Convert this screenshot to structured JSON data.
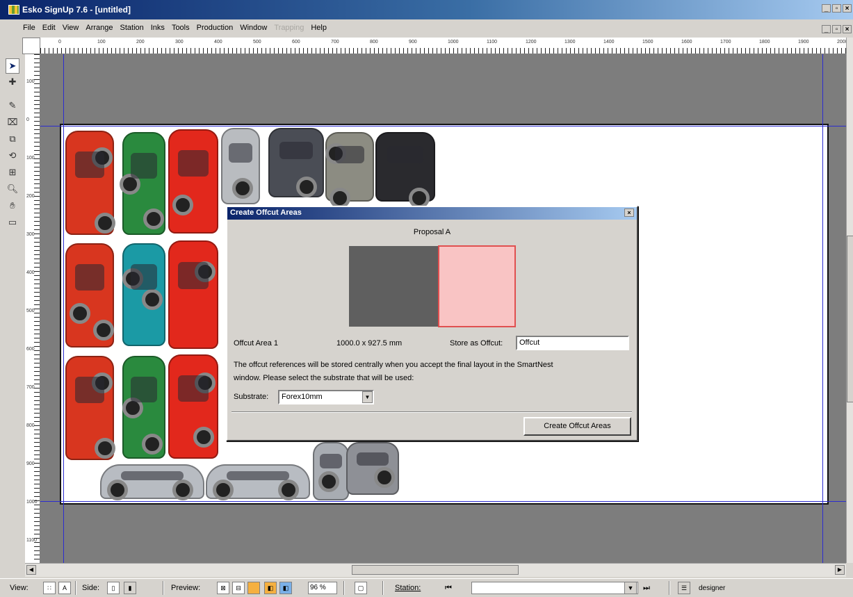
{
  "window": {
    "title": "Esko SignUp 7.6 - [untitled]",
    "controls": [
      "_",
      "̈",
      "x"
    ]
  },
  "menu": {
    "items": [
      "File",
      "Edit",
      "View",
      "Arrange",
      "Station",
      "Inks",
      "Tools",
      "Production",
      "Window",
      "Trapping",
      "Help"
    ],
    "disabled": [
      "Trapping"
    ]
  },
  "ruler": {
    "top_labels": [
      "0",
      "100",
      "200",
      "300",
      "400",
      "500",
      "600",
      "700",
      "800",
      "900",
      "1000",
      "1100",
      "1200",
      "1300",
      "1400",
      "1500",
      "1600",
      "1700",
      "1800",
      "1900",
      "2000"
    ],
    "left_labels": [
      "100",
      "0",
      "100",
      "200",
      "300",
      "400",
      "500",
      "600",
      "700",
      "800",
      "900",
      "1000",
      "1100"
    ]
  },
  "tools": [
    "select-arrow-icon",
    "node-edit-icon",
    "pencil-icon",
    "crop-icon",
    "transform-icon",
    "rotate-icon",
    "distort-icon",
    "zoom-icon",
    "hand-icon",
    "measure-icon"
  ],
  "dialog": {
    "title": "Create Offcut Areas",
    "close": "x",
    "proposal": "Proposal A",
    "area_label": "Offcut Area 1",
    "area_size": "1000.0 x  927.5 mm",
    "store_label": "Store as Offcut:",
    "store_value": "Offcut",
    "info_line1": "The offcut references will be stored centrally when you accept the final layout in the SmartNest",
    "info_line2": "window. Please select the substrate that will be used:",
    "substrate_label": "Substrate:",
    "substrate_value": "Forex10mm",
    "create_button": "Create Offcut Areas"
  },
  "status": {
    "view_label": "View:",
    "side_label": "Side:",
    "preview_label": "Preview:",
    "zoom_value": "96 %",
    "station_label": "Station:",
    "user_label": "designer"
  }
}
